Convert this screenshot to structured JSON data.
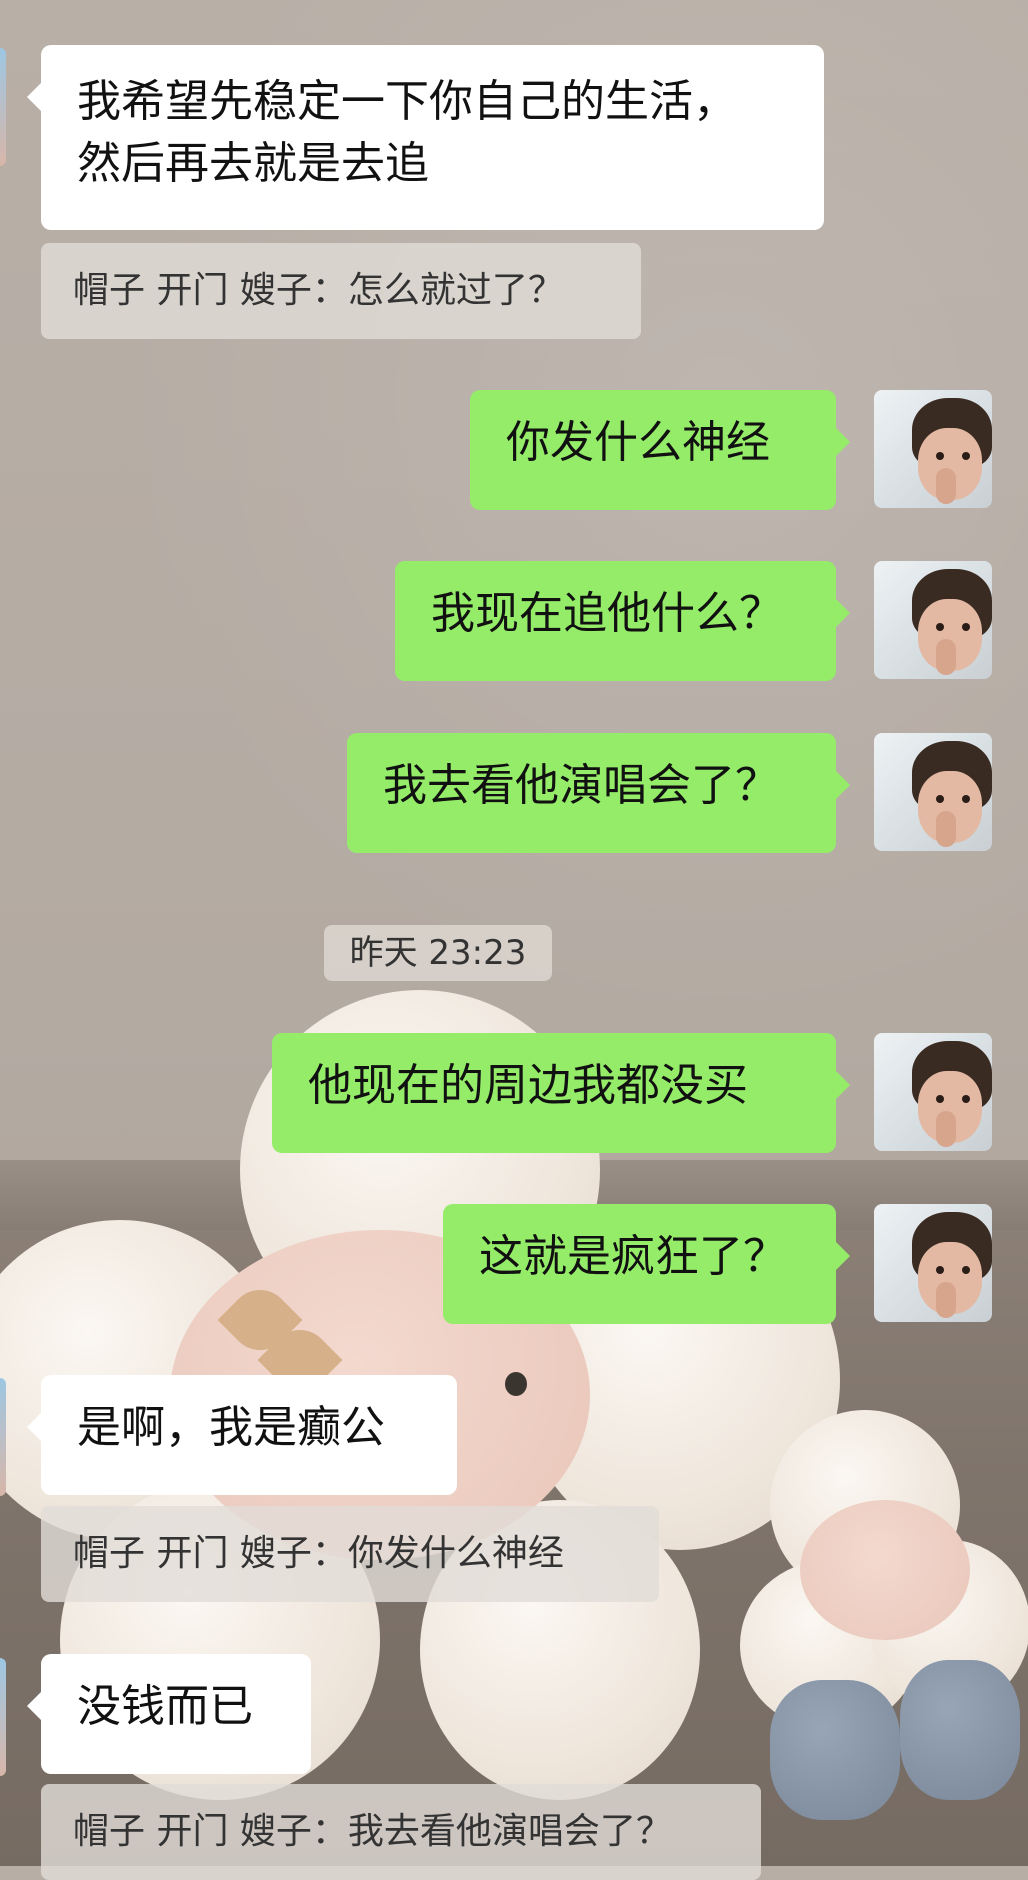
{
  "chat": {
    "messages": [
      {
        "id": "m1",
        "side": "left",
        "text_lines": [
          "我希望先稳定一下你自己的生活，",
          "然后再去就是去追"
        ]
      },
      {
        "id": "q1",
        "type": "quote",
        "text": "帽子 开门 嫂子：怎么就过了？"
      },
      {
        "id": "m2",
        "side": "right",
        "text": "你发什么神经"
      },
      {
        "id": "m3",
        "side": "right",
        "text": "我现在追他什么？"
      },
      {
        "id": "m4",
        "side": "right",
        "text": "我去看他演唱会了？"
      },
      {
        "id": "t1",
        "type": "timestamp",
        "text": "昨天 23:23"
      },
      {
        "id": "m5",
        "side": "right",
        "text": "他现在的周边我都没买"
      },
      {
        "id": "m6",
        "side": "right",
        "text": "这就是疯狂了？"
      },
      {
        "id": "m7",
        "side": "left",
        "text": "是啊，我是癫公"
      },
      {
        "id": "q2",
        "type": "quote",
        "text": "帽子 开门 嫂子：你发什么神经"
      },
      {
        "id": "m8",
        "side": "left",
        "text": "没钱而已"
      },
      {
        "id": "q3",
        "type": "quote",
        "text": "帽子 开门 嫂子：我去看他演唱会了？"
      }
    ]
  },
  "colors": {
    "self_bubble": "#95ec69",
    "other_bubble": "#ffffff",
    "quote_bg": "#e1dcd7"
  },
  "icons": {
    "self_avatar": "avatar-child-photo-icon",
    "other_avatar": "avatar-cropped-icon"
  }
}
